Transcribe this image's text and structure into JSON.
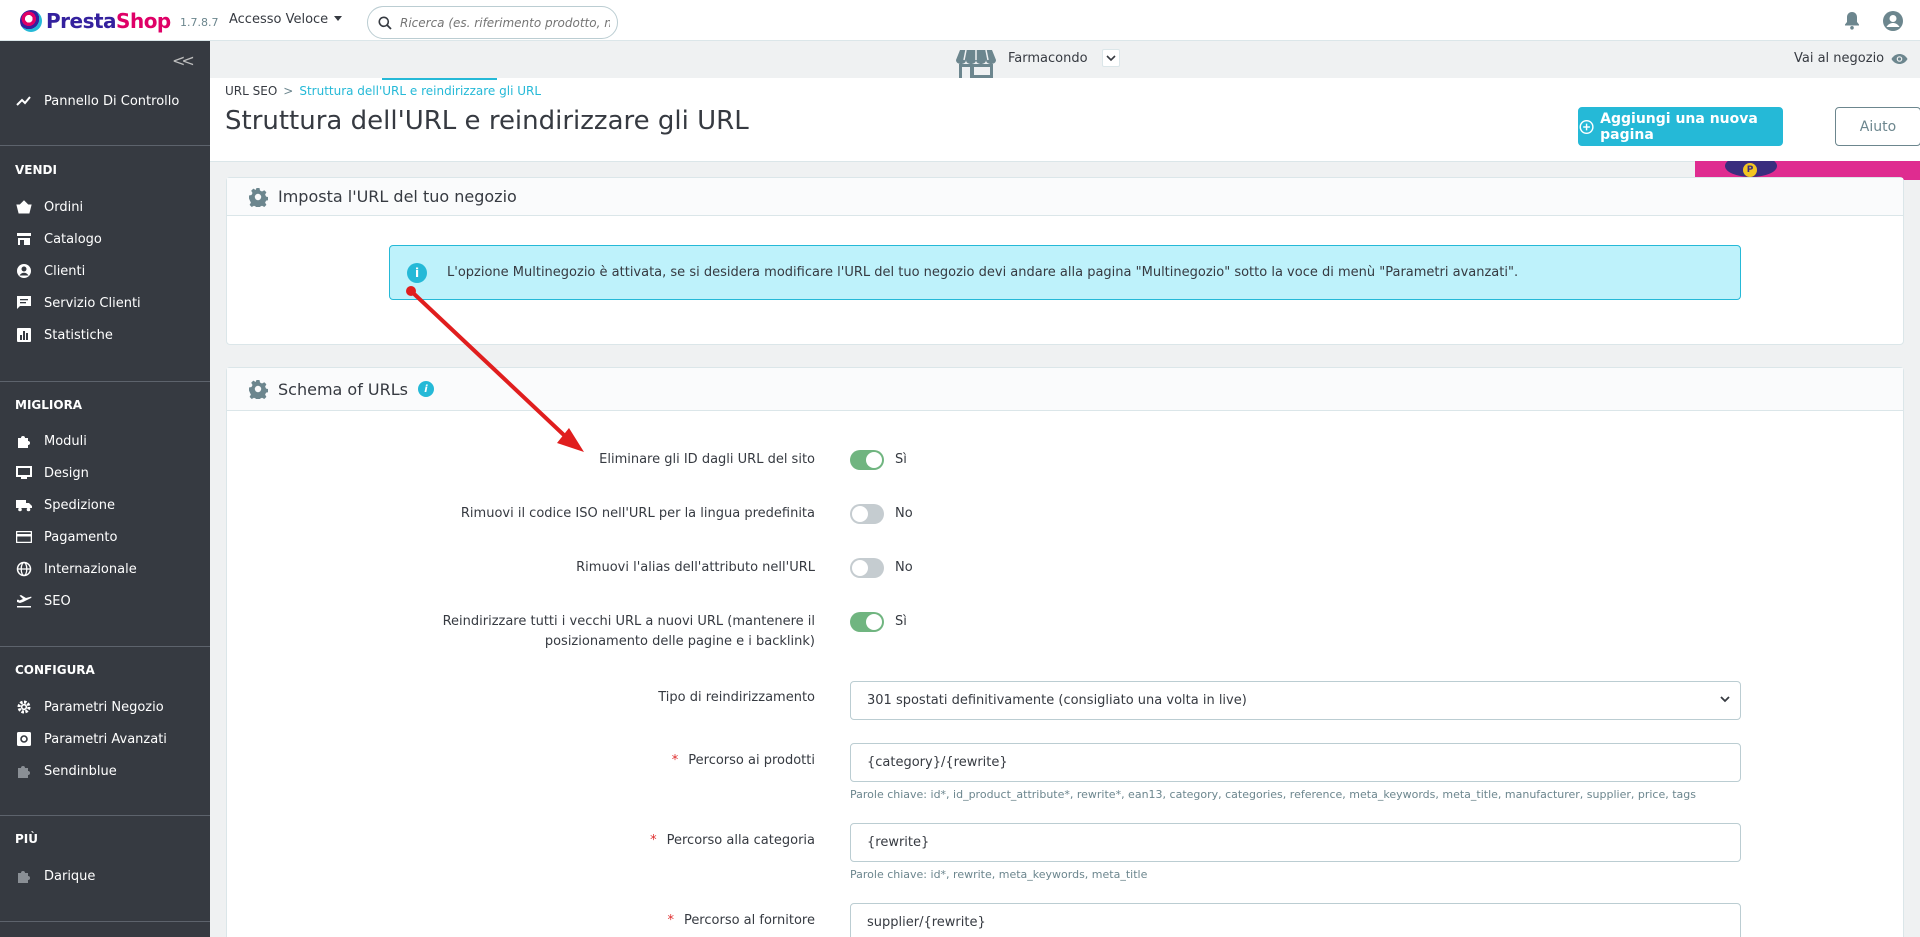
{
  "header": {
    "brand_part1": "Presta",
    "brand_part2": "Shop",
    "version": "1.7.8.7",
    "quick_access": "Accesso Veloce",
    "search_placeholder": "Ricerca (es. riferimento prodotto, nom"
  },
  "sidebar": {
    "dashboard": "Pannello Di Controllo",
    "sections": [
      {
        "title": "VENDI",
        "items": [
          "Ordini",
          "Catalogo",
          "Clienti",
          "Servizio Clienti",
          "Statistiche"
        ]
      },
      {
        "title": "MIGLIORA",
        "items": [
          "Moduli",
          "Design",
          "Spedizione",
          "Pagamento",
          "Internazionale",
          "SEO"
        ]
      },
      {
        "title": "CONFIGURA",
        "items": [
          "Parametri Negozio",
          "Parametri Avanzati",
          "Sendinblue"
        ]
      },
      {
        "title": "PIÙ",
        "items": [
          "Darique"
        ]
      }
    ]
  },
  "storebar": {
    "store_name": "Farmacondo",
    "goto_shop": "Vai al negozio"
  },
  "page": {
    "breadcrumb_parent": "URL SEO",
    "breadcrumb_sep": ">",
    "breadcrumb_current": "Struttura dell'URL e reindirizzare gli URL",
    "title": "Struttura dell'URL e reindirizzare gli URL",
    "add_button": "Aggiungi una nuova pagina",
    "help_button": "Aiuto"
  },
  "panel_shop_url": {
    "title": "Imposta l'URL del tuo negozio",
    "alert": "L'opzione Multinegozio è attivata, se si desidera modificare l'URL del tuo negozio devi andare alla pagina \"Multinegozio\" sotto la voce di menù \"Parametri avanzati\"."
  },
  "panel_schema": {
    "title": "Schema of URLs",
    "toggles": [
      {
        "label": "Eliminare gli ID dagli URL del sito",
        "state": "Sì",
        "on": true
      },
      {
        "label": "Rimuovi il codice ISO nell'URL per la lingua predefinita",
        "state": "No",
        "on": false
      },
      {
        "label": "Rimuovi l'alias dell'attributo nell'URL",
        "state": "No",
        "on": false
      },
      {
        "label_line1": "Reindirizzare tutti i vecchi URL a nuovi URL (mantenere il",
        "label_line2": "posizionamento delle pagine e i backlink)",
        "state": "Sì",
        "on": true
      }
    ],
    "redirect_label": "Tipo di reindirizzamento",
    "redirect_value": "301 spostati definitivamente (consigliato una volta in live)",
    "routes": [
      {
        "required": "*",
        "label": "Percorso ai prodotti",
        "value": "{category}/{rewrite}",
        "hint": "Parole chiave: id*, id_product_attribute*, rewrite*, ean13, category, categories, reference, meta_keywords, meta_title, manufacturer, supplier, price, tags"
      },
      {
        "required": "*",
        "label": "Percorso alla categoria",
        "value": "{rewrite}",
        "hint": "Parole chiave: id*, rewrite, meta_keywords, meta_title"
      },
      {
        "required": "*",
        "label": "Percorso al fornitore",
        "value": "supplier/{rewrite}"
      }
    ]
  },
  "colors": {
    "accent": "#25b9d7",
    "brand_pink": "#df0067",
    "sidebar_bg": "#363a41",
    "switch_on": "#70b580",
    "arrow": "#e01e1e"
  }
}
